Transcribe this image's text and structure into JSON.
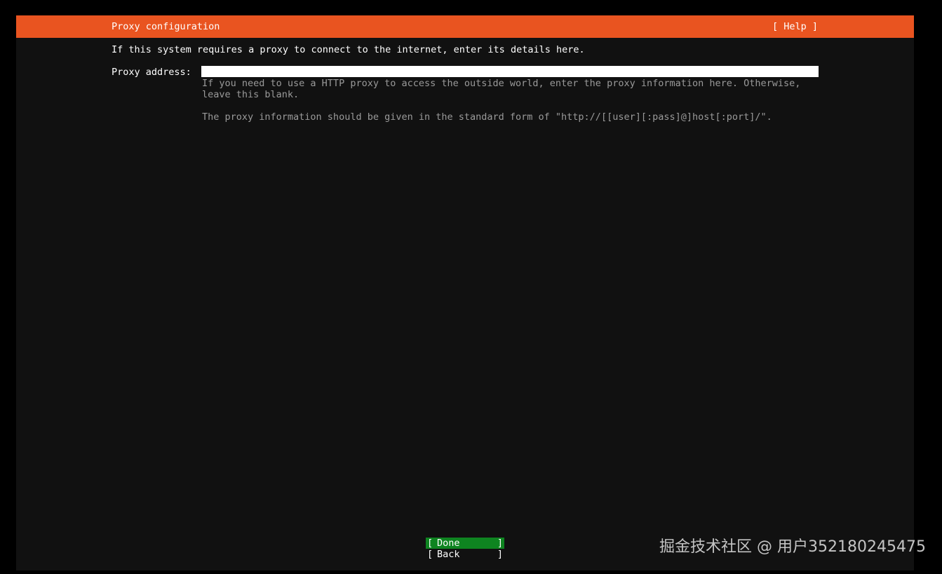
{
  "header": {
    "title": "Proxy configuration",
    "help_label": "[ Help ]"
  },
  "intro": "If this system requires a proxy to connect to the internet, enter its details here.",
  "proxy_field": {
    "label": "Proxy address:",
    "value": "",
    "help_line1": "If you need to use a HTTP proxy to access the outside world, enter the proxy information here. Otherwise,\nleave this blank.",
    "help_line2": "The proxy information should be given in the standard form of \"http://[[user][:pass]@]host[:port]/\"."
  },
  "buttons": {
    "done": {
      "bracket_left": "[",
      "label": "Done",
      "bracket_right": "]"
    },
    "back": {
      "bracket_left": "[",
      "label": "Back",
      "bracket_right": "]"
    }
  },
  "watermark": "掘金技术社区 @ 用户352180245475",
  "colors": {
    "header_bg": "#e95420",
    "screen_bg": "#111111",
    "focused_button_bg": "#0e8420",
    "input_bg": "#ffffff",
    "help_text": "#9a9a9a"
  }
}
